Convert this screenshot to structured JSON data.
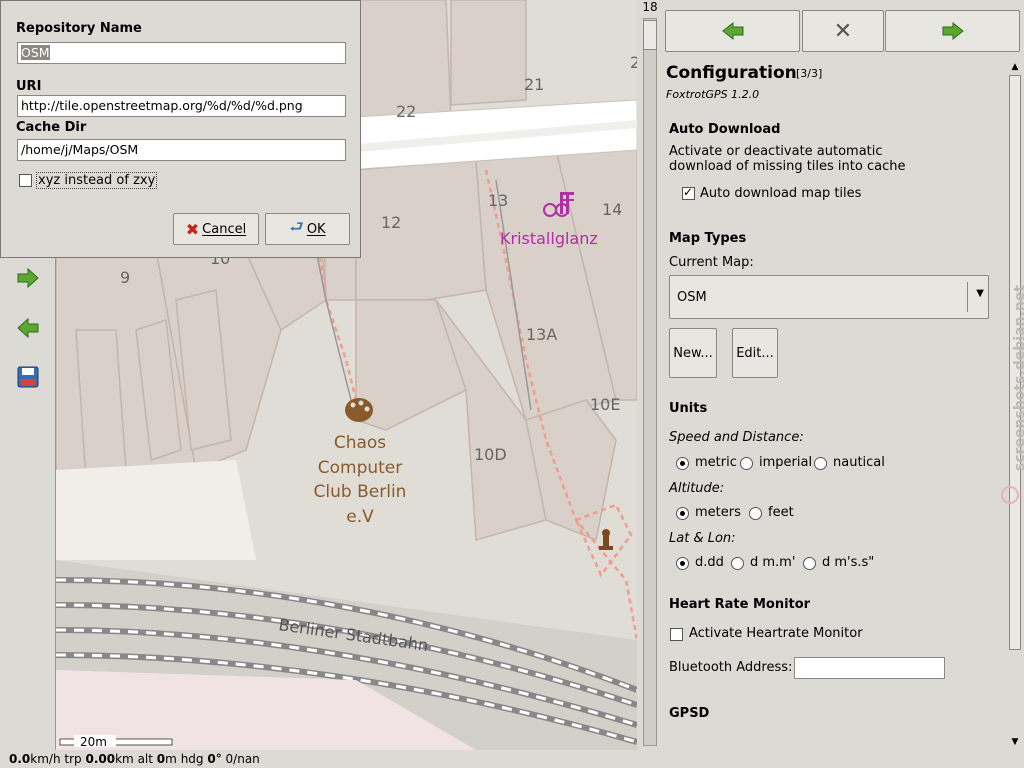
{
  "dialog": {
    "repo_label": "Repository Name",
    "repo_value": "OSM",
    "uri_label": "URI",
    "uri_value": "http://tile.openstreetmap.org/%d/%d/%d.png",
    "cache_label": "Cache Dir",
    "cache_value": "/home/j/Maps/OSM",
    "xyz_label": "xyz instead of zxy",
    "xyz_checked": false,
    "cancel_label": "Cancel",
    "ok_label": "OK"
  },
  "map": {
    "labels": {
      "n21": "21",
      "n22": "22",
      "n13": "13",
      "n14": "14",
      "n12": "12",
      "n10": "10",
      "n9": "9",
      "n13a": "13A",
      "n10e": "10E",
      "n10d": "10D",
      "n2": "2",
      "poi1": "Kristallglanz",
      "poi2_l1": "Chaos",
      "poi2_l2": "Computer",
      "poi2_l3": "Club Berlin",
      "poi2_l4": "e.V",
      "rail": "Berliner Stadtbahn"
    },
    "scale": "20m"
  },
  "zoom": {
    "level": "18"
  },
  "status": {
    "speed_val": "0.0",
    "speed_unit": "km/h",
    "trp_label": "trp",
    "trp_val": "0.00",
    "trp_unit": "km",
    "alt_label": "alt",
    "alt_val": "0",
    "alt_unit": "m",
    "hdg_label": "hdg",
    "hdg_val": "0°",
    "extra": "0/nan"
  },
  "config": {
    "title": "Configuration",
    "page": "[3/3]",
    "version": "FoxtrotGPS 1.2.0",
    "auto_download": {
      "title": "Auto Download",
      "desc_l1": "Activate or deactivate automatic",
      "desc_l2": "download of missing tiles into cache",
      "checkbox_label": "Auto download map tiles",
      "checked": true
    },
    "map_types": {
      "title": "Map Types",
      "current_label": "Current Map:",
      "current_value": "OSM",
      "new_label": "New...",
      "edit_label": "Edit..."
    },
    "units": {
      "title": "Units",
      "speed_label": "Speed and Distance:",
      "speed_options": [
        "metric",
        "imperial",
        "nautical"
      ],
      "speed_selected": "metric",
      "alt_label": "Altitude:",
      "alt_options": [
        "meters",
        "feet"
      ],
      "alt_selected": "meters",
      "latlon_label": "Lat & Lon:",
      "latlon_options": [
        "d.dd",
        "d m.m'",
        "d m's.s\""
      ],
      "latlon_selected": "d.dd"
    },
    "heart_rate": {
      "title": "Heart Rate Monitor",
      "checkbox_label": "Activate Heartrate Monitor",
      "checked": false,
      "bt_label": "Bluetooth Address:",
      "bt_value": ""
    },
    "gpsd": {
      "title": "GPSD"
    }
  },
  "watermark": "screenshots.debian.net",
  "colors": {
    "arrow_green": "#5aa832",
    "poi_magenta": "#b02fa4",
    "poi_brown": "#8a5a2b",
    "path_red": "#f29c8f"
  }
}
